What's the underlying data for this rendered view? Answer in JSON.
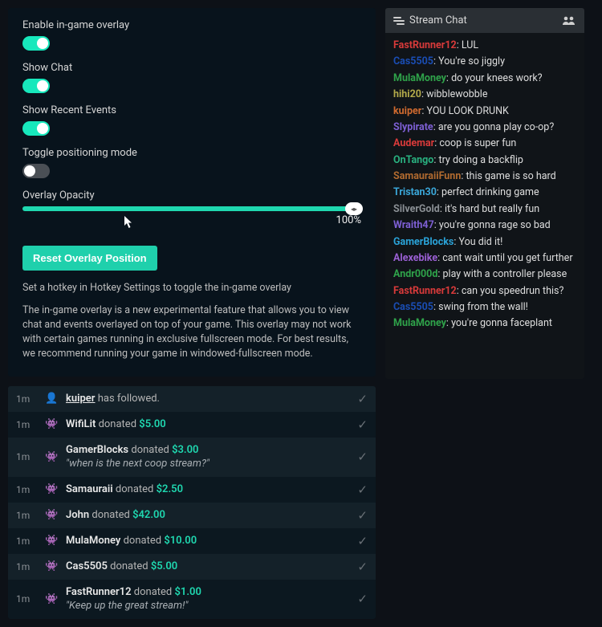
{
  "settings": {
    "enable_overlay": {
      "label": "Enable in-game overlay",
      "on": true
    },
    "show_chat": {
      "label": "Show Chat",
      "on": true
    },
    "show_events": {
      "label": "Show Recent Events",
      "on": true
    },
    "positioning_mode": {
      "label": "Toggle positioning mode",
      "on": false
    },
    "opacity": {
      "label": "Overlay Opacity",
      "value": "100%"
    },
    "reset_btn": "Reset Overlay Position",
    "hotkey_help": "Set a hotkey in Hotkey Settings to toggle the in-game overlay",
    "description": "The in-game overlay is a new experimental feature that allows you to view chat and events overlayed on top of your game. This overlay may not work with certain games running in exclusive fullscreen mode. For best results, we recommend running your game in windowed-fullscreen mode."
  },
  "events": [
    {
      "time": "1m",
      "icon": "👤",
      "user": "kuiper",
      "kind": "follow",
      "underline": true
    },
    {
      "time": "1m",
      "icon": "👾",
      "user": "WifiLit",
      "kind": "donate",
      "amount": "$5.00"
    },
    {
      "time": "1m",
      "icon": "👾",
      "user": "GamerBlocks",
      "kind": "donate",
      "amount": "$3.00",
      "quote": "\"when is the next coop stream?\""
    },
    {
      "time": "1m",
      "icon": "👾",
      "user": "Samauraii",
      "kind": "donate",
      "amount": "$2.50"
    },
    {
      "time": "1m",
      "icon": "👾",
      "user": "John",
      "kind": "donate",
      "amount": "$42.00"
    },
    {
      "time": "1m",
      "icon": "👾",
      "user": "MulaMoney",
      "kind": "donate",
      "amount": "$10.00"
    },
    {
      "time": "1m",
      "icon": "👾",
      "user": "Cas5505",
      "kind": "donate",
      "amount": "$5.00"
    },
    {
      "time": "1m",
      "icon": "👾",
      "user": "FastRunner12",
      "kind": "donate",
      "amount": "$1.00",
      "quote": "\"Keep up the great stream!\""
    }
  ],
  "event_words": {
    "donated": "donated",
    "followed": "has followed."
  },
  "chat": {
    "title": "Stream Chat",
    "lines": [
      {
        "user": "FastRunner12",
        "color": "#d83a3a",
        "msg": "LUL"
      },
      {
        "user": "Cas5505",
        "color": "#1a4db3",
        "msg": "You're so jiggly"
      },
      {
        "user": "MulaMoney",
        "color": "#2fa34a",
        "msg": "do your knees work?"
      },
      {
        "user": "hihi20",
        "color": "#b2a94a",
        "msg": "wibblewobble"
      },
      {
        "user": "kuiper",
        "color": "#d06a2f",
        "msg": "YOU LOOK DRUNK"
      },
      {
        "user": "Slypirate",
        "color": "#7d5fd3",
        "msg": "are you gonna play co-op?"
      },
      {
        "user": "Audemar",
        "color": "#d83a3a",
        "msg": "coop is super fun"
      },
      {
        "user": "OnTango",
        "color": "#29b07f",
        "msg": "try doing a backflip"
      },
      {
        "user": "SamauraiiFunn",
        "color": "#b06a2f",
        "msg": "this game is so hard"
      },
      {
        "user": "Tristan30",
        "color": "#3aa6d8",
        "msg": "perfect drinking game"
      },
      {
        "user": "SilverGold",
        "color": "#8a8f94",
        "msg": "it's hard but really fun"
      },
      {
        "user": "Wraith47",
        "color": "#7d5fd3",
        "msg": "you're gonna rage so bad"
      },
      {
        "user": "GamerBlocks",
        "color": "#2aa3d8",
        "msg": "You did it!"
      },
      {
        "user": "Alexebike",
        "color": "#9a5fd3",
        "msg": "cant wait until you get further"
      },
      {
        "user": "Andr000d",
        "color": "#2fa34a",
        "msg": "play with a controller please"
      },
      {
        "user": "FastRunner12",
        "color": "#d83a3a",
        "msg": "can you speedrun this?"
      },
      {
        "user": "Cas5505",
        "color": "#1a4db3",
        "msg": "swing from the wall!"
      },
      {
        "user": "MulaMoney",
        "color": "#2fa34a",
        "msg": "you're gonna faceplant"
      }
    ]
  }
}
